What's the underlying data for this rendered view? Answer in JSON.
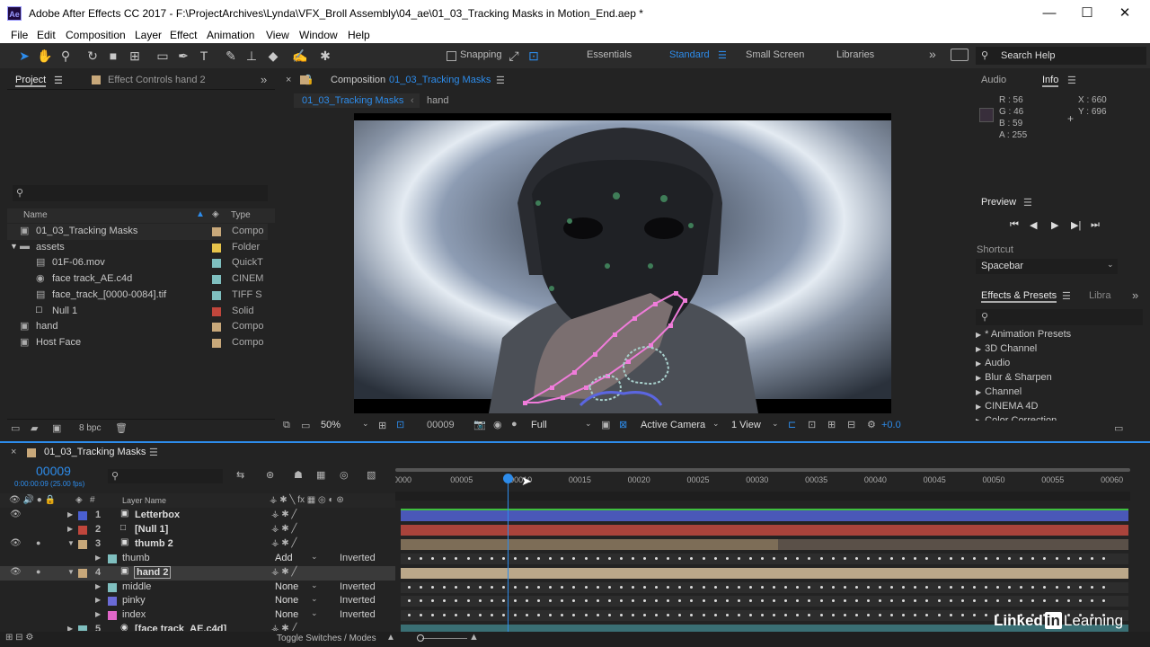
{
  "window": {
    "logo": "Ae",
    "title": "Adobe After Effects CC 2017 - F:\\ProjectArchives\\Lynda\\VFX_Broll Assembly\\04_ae\\01_03_Tracking Masks in Motion_End.aep *",
    "minimize": "—",
    "maximize": "☐",
    "close": "✕"
  },
  "menu": [
    "File",
    "Edit",
    "Composition",
    "Layer",
    "Effect",
    "Animation",
    "View",
    "Window",
    "Help"
  ],
  "toolbar": {
    "snapping": "Snapping",
    "workspaces": [
      "Essentials",
      "Standard",
      "Small Screen",
      "Libraries"
    ],
    "search_placeholder": "Search Help",
    "more": "»"
  },
  "project": {
    "tab": "Project",
    "effect_controls": "Effect Controls hand 2",
    "col_name": "Name",
    "col_type": "Type",
    "depth": "8 bpc",
    "items": [
      {
        "name": "01_03_Tracking Masks",
        "type": "Compo",
        "color": "#c8a87a",
        "indent": 0,
        "icon": "comp"
      },
      {
        "name": "assets",
        "type": "Folder",
        "color": "#e6c34a",
        "indent": 0,
        "icon": "folder"
      },
      {
        "name": "01F-06.mov",
        "type": "QuickT",
        "color": "#7fbfbf",
        "indent": 1,
        "icon": "footage"
      },
      {
        "name": "face track_AE.c4d",
        "type": "CINEM",
        "color": "#7fbfbf",
        "indent": 1,
        "icon": "c4d"
      },
      {
        "name": "face_track_[0000-0084].tif",
        "type": "TIFF S",
        "color": "#7fbfbf",
        "indent": 1,
        "icon": "footage"
      },
      {
        "name": "Null 1",
        "type": "Solid",
        "color": "#c0463c",
        "indent": 1,
        "icon": "solid"
      },
      {
        "name": "hand",
        "type": "Compo",
        "color": "#c8a87a",
        "indent": 0,
        "icon": "comp"
      },
      {
        "name": "Host Face",
        "type": "Compo",
        "color": "#c8a87a",
        "indent": 0,
        "icon": "comp"
      }
    ]
  },
  "composition": {
    "tab_label": "Composition",
    "comp_name": "01_03_Tracking Masks",
    "crumb1": "01_03_Tracking Masks",
    "crumb2": "hand",
    "zoom": "50%",
    "timecode": "00009",
    "resolution": "Full",
    "camera": "Active Camera",
    "views": "1 View",
    "exposure": "+0.0"
  },
  "info": {
    "tab_audio": "Audio",
    "tab_info": "Info",
    "r": "R : 56",
    "g": "G : 46",
    "b": "B : 59",
    "a": "A : 255",
    "x": "X : 660",
    "y": "Y : 696"
  },
  "preview": {
    "title": "Preview",
    "shortcut_label": "Shortcut",
    "shortcut": "Spacebar"
  },
  "effects": {
    "title": "Effects & Presets",
    "libraries": "Libra",
    "items": [
      "* Animation Presets",
      "3D Channel",
      "Audio",
      "Blur & Sharpen",
      "Channel",
      "CINEMA 4D",
      "Color Correction"
    ]
  },
  "timeline": {
    "tab": "01_03_Tracking Masks",
    "timecode": "00009",
    "fps": "0:00:00:09 (25.00 fps)",
    "col_layer": "Layer Name",
    "toggle": "Toggle Switches / Modes",
    "ticks": [
      "0000",
      "00005",
      "00010",
      "00015",
      "00020",
      "00025",
      "00030",
      "00035",
      "00040",
      "00045",
      "00050",
      "00055",
      "00060"
    ],
    "layers": [
      {
        "num": "1",
        "name": "Letterbox",
        "color": "#4a5fd1",
        "bar": "#4a58b8"
      },
      {
        "num": "2",
        "name": "[Null 1]",
        "color": "#c0463c",
        "bar": "#a9433b"
      },
      {
        "num": "3",
        "name": "thumb 2",
        "color": "#c8a87a",
        "bar": "#7d6d57"
      },
      {
        "num": "4",
        "name": "hand 2",
        "color": "#c8a87a",
        "bar": "#bba88a"
      },
      {
        "num": "5",
        "name": "[face track_AE.c4d]",
        "color": "#7fbfbf",
        "bar": "#3a6f74"
      }
    ],
    "masks": [
      {
        "name": "thumb",
        "mode": "Add",
        "inv": "Inverted",
        "color": "#7fbfbf"
      },
      {
        "name": "middle",
        "mode": "None",
        "inv": "Inverted",
        "color": "#7fbfbf"
      },
      {
        "name": "pinky",
        "mode": "None",
        "inv": "Inverted",
        "color": "#6b6bd6"
      },
      {
        "name": "index",
        "mode": "None",
        "inv": "Inverted",
        "color": "#e066c8"
      }
    ]
  },
  "watermark": {
    "a": "Linked",
    "b": "in",
    "c": "Learning"
  },
  "colors": {
    "accent": "#2d8ceb",
    "selection": "#4a4a4a"
  }
}
